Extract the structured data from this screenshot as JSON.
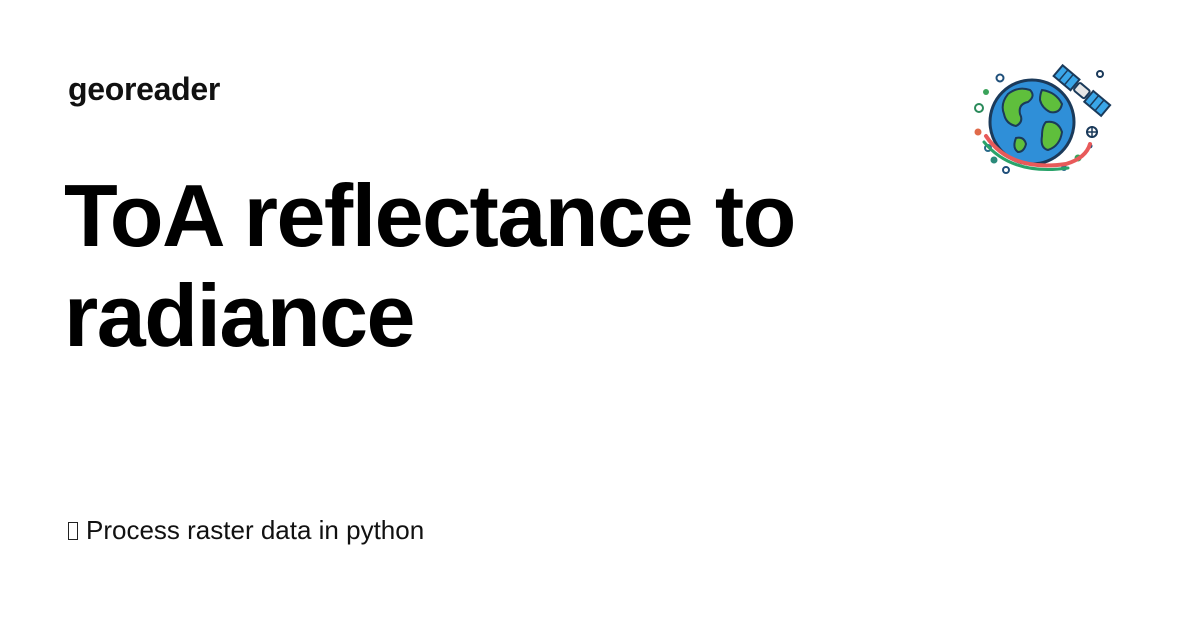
{
  "site": {
    "name": "georeader"
  },
  "article": {
    "title": "ToA reflectance to radiance",
    "tagline": "Process raster data in python",
    "tagline_icon": "missing-glyph-icon"
  },
  "logo": {
    "icon": "globe-satellite-logo-icon"
  },
  "colors": {
    "background": "#ffffff",
    "text": "#000000",
    "logo_ocean": "#2f8fd8",
    "logo_land": "#5fbf3c",
    "logo_orbit": "#e85a5a",
    "logo_panel": "#3aa6e8"
  }
}
